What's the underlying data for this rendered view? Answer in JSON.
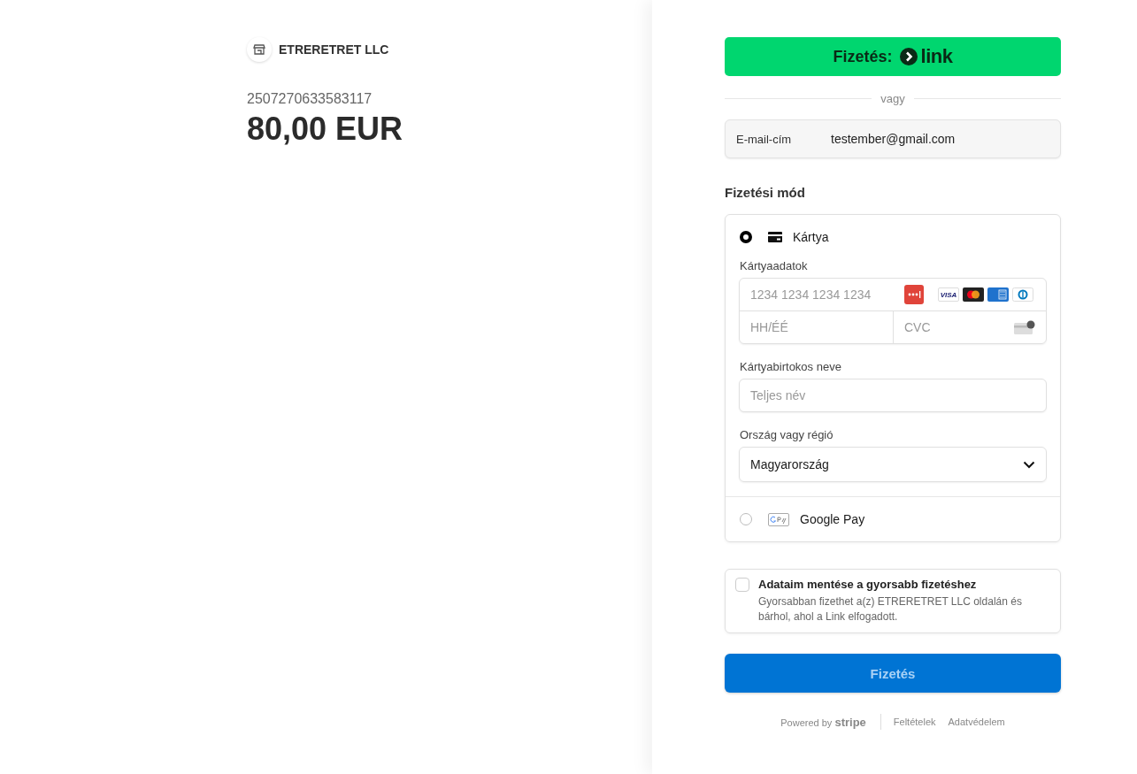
{
  "merchant": {
    "name": "ETRERETRET LLC"
  },
  "order": {
    "reference": "2507270633583117",
    "amount": "80,00 EUR"
  },
  "link_button": {
    "label": "Fizetés:",
    "brand": "link"
  },
  "divider": {
    "label": "vagy"
  },
  "email": {
    "label": "E-mail-cím",
    "value": "testember@gmail.com"
  },
  "payment_section": {
    "title": "Fizetési mód"
  },
  "methods": [
    {
      "kind": "card",
      "label": "Kártya",
      "selected": true,
      "card_label": "Kártyaadatok",
      "number_placeholder": "1234 1234 1234 1234",
      "brands": [
        {
          "kind": "visa",
          "label": "VISA"
        },
        {
          "kind": "mastercard"
        },
        {
          "kind": "amex"
        },
        {
          "kind": "diners"
        }
      ],
      "expiry_placeholder": "HH/ÉÉ",
      "cvc_placeholder": "CVC",
      "name_label": "Kártyabirtokos neve",
      "name_placeholder": "Teljes név",
      "country_label": "Ország vagy régió",
      "country_value": "Magyarország"
    },
    {
      "kind": "googlepay",
      "label": "Google Pay",
      "selected": false
    }
  ],
  "save": {
    "checked": false,
    "title": "Adataim mentése a gyorsabb fizetéshez",
    "description": "Gyorsabban fizethet a(z) ETRERETRET LLC oldalán és bárhol, ahol a Link elfogadott."
  },
  "pay_button": {
    "label": "Fizetés"
  },
  "footer": {
    "powered": "Powered by",
    "brand": "stripe",
    "links": [
      "Feltételek",
      "Adatvédelem"
    ]
  }
}
